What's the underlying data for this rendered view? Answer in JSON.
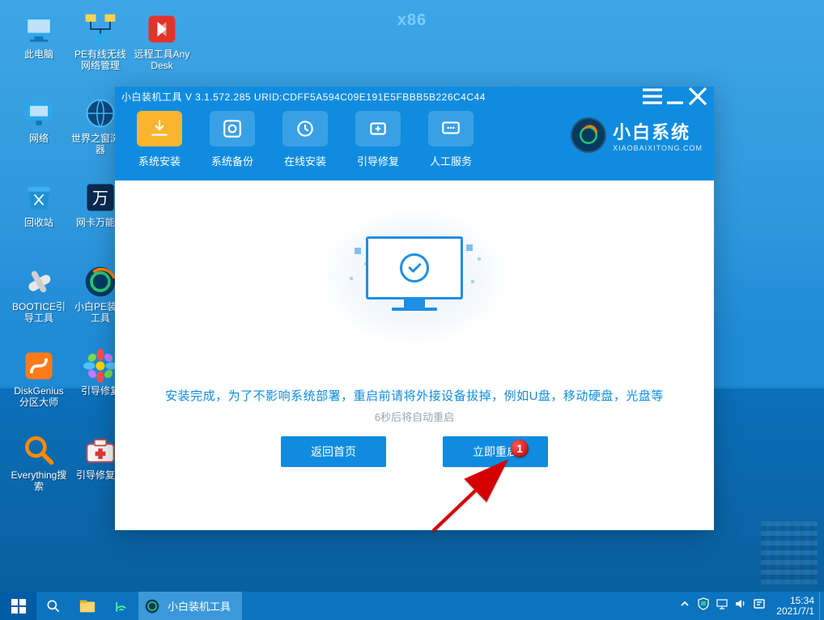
{
  "watermark": "x86",
  "desktop_icons": {
    "col0": [
      {
        "label": "此电脑",
        "icon": "pc"
      },
      {
        "label": "网络",
        "icon": "network"
      },
      {
        "label": "回收站",
        "icon": "recycle"
      },
      {
        "label": "BOOTICE引导工具",
        "icon": "bootice"
      },
      {
        "label": "DiskGenius分区大师",
        "icon": "diskgenius"
      },
      {
        "label": "Everything搜索",
        "icon": "everything"
      }
    ],
    "col1": [
      {
        "label": "PE有线无线网络管理",
        "icon": "pe-net"
      },
      {
        "label": "世界之窗浏览器",
        "icon": "browser"
      },
      {
        "label": "网卡万能驱",
        "icon": "wan"
      },
      {
        "label": "小白PE装机工具",
        "icon": "xiaobai"
      },
      {
        "label": "引导修复",
        "icon": "flower"
      },
      {
        "label": "引导修复工",
        "icon": "firstaid"
      }
    ],
    "col2": [
      {
        "label": "远程工具AnyDesk",
        "icon": "anydesk"
      }
    ]
  },
  "window": {
    "title": "小白装机工具 V 3.1.572.285 URID:CDFF5A594C09E191E5FBBB5B226C4C44",
    "tabs": [
      {
        "label": "系统安装",
        "icon": "install",
        "active": true
      },
      {
        "label": "系统备份",
        "icon": "backup",
        "active": false
      },
      {
        "label": "在线安装",
        "icon": "online",
        "active": false
      },
      {
        "label": "引导修复",
        "icon": "boot",
        "active": false
      },
      {
        "label": "人工服务",
        "icon": "chat",
        "active": false
      }
    ],
    "brand_cn": "小白系统",
    "brand_en": "XIAOBAIXITONG.COM",
    "message": "安装完成，为了不影响系统部署，重启前请将外接设备拔掉，例如U盘，移动硬盘，光盘等",
    "sub_message": "6秒后将自动重启",
    "back_btn": "返回首页",
    "restart_btn": "立即重启",
    "annotation_number": "1"
  },
  "taskbar": {
    "app_label": "小白装机工具",
    "time": "15:34",
    "date": "2021/7/1"
  }
}
